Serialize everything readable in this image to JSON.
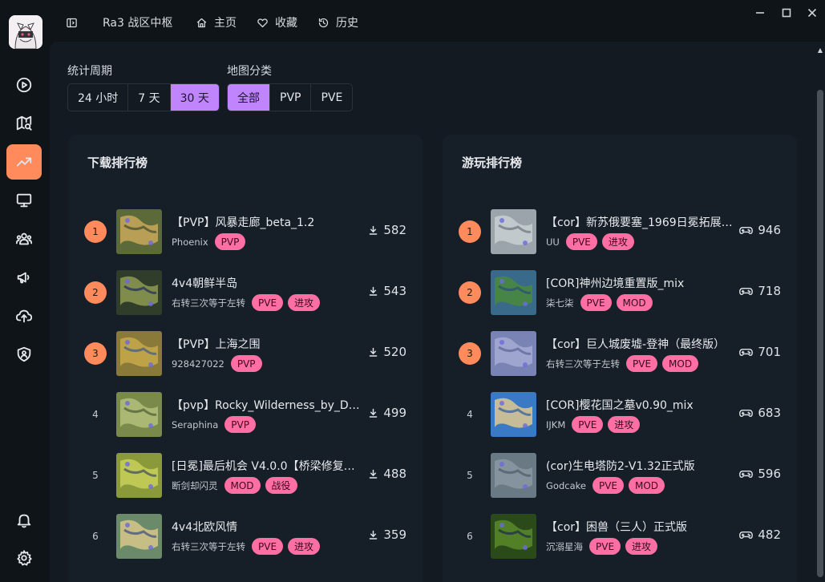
{
  "app": {
    "title": "Ra3 战区中枢"
  },
  "nav": {
    "home": "主页",
    "favorites": "收藏",
    "history": "历史"
  },
  "filters": {
    "period_label": "统计周期",
    "period_options": [
      "24 小时",
      "7 天",
      "30 天"
    ],
    "period_selected": "30 天",
    "category_label": "地图分类",
    "category_options": [
      "全部",
      "PVP",
      "PVE"
    ],
    "category_selected": "全部"
  },
  "download_ranking": {
    "title": "下载排行榜",
    "items": [
      {
        "rank": "1",
        "title": "【PVP】风暴走廊_beta_1.2",
        "author": "Phoenix",
        "tags": [
          "PVP"
        ],
        "count": "582"
      },
      {
        "rank": "2",
        "title": "4v4朝鲜半岛",
        "author": "右转三次等于左转",
        "tags": [
          "PVE",
          "进攻"
        ],
        "count": "543"
      },
      {
        "rank": "3",
        "title": "【PVP】上海之围",
        "author": "928427022",
        "tags": [
          "PVP"
        ],
        "count": "520"
      },
      {
        "rank": "4",
        "title": "【pvp】Rocky_Wilderness_by_Dan…",
        "author": "Seraphina",
        "tags": [
          "PVP"
        ],
        "count": "499"
      },
      {
        "rank": "5",
        "title": "[日冕]最后机会 V4.0.0【桥梁修复版…",
        "author": "断剑却闪灵",
        "tags": [
          "MOD",
          "战役"
        ],
        "count": "488"
      },
      {
        "rank": "6",
        "title": "4v4北欧风情",
        "author": "右转三次等于左转",
        "tags": [
          "PVE",
          "进攻"
        ],
        "count": "359"
      }
    ]
  },
  "play_ranking": {
    "title": "游玩排行榜",
    "items": [
      {
        "rank": "1",
        "title": "【cor】新苏俄要塞_1969日冕拓展…",
        "author": "UU",
        "tags": [
          "PVE",
          "进攻"
        ],
        "count": "946"
      },
      {
        "rank": "2",
        "title": "[COR]神州边境重置版_mix",
        "author": "柒七柒",
        "tags": [
          "PVE",
          "MOD"
        ],
        "count": "718"
      },
      {
        "rank": "3",
        "title": "【cor】巨人城废墟-登神（最终版）",
        "author": "右转三次等于左转",
        "tags": [
          "PVE",
          "MOD"
        ],
        "count": "701"
      },
      {
        "rank": "4",
        "title": "[COR]樱花国之墓v0.90_mix",
        "author": "IJKM",
        "tags": [
          "PVE",
          "进攻"
        ],
        "count": "683"
      },
      {
        "rank": "5",
        "title": "(cor)生电塔防2-V1.32正式版",
        "author": "Godcake",
        "tags": [
          "PVE",
          "MOD"
        ],
        "count": "596"
      },
      {
        "rank": "6",
        "title": "【cor】困兽（三人）正式版",
        "author": "沉溺星海",
        "tags": [
          "PVE",
          "进攻"
        ],
        "count": "482"
      }
    ]
  },
  "colors": {
    "accent_orange": "#ff8a5c",
    "accent_purple": "#c084fc",
    "tag_pink": "#ff6fa3"
  }
}
